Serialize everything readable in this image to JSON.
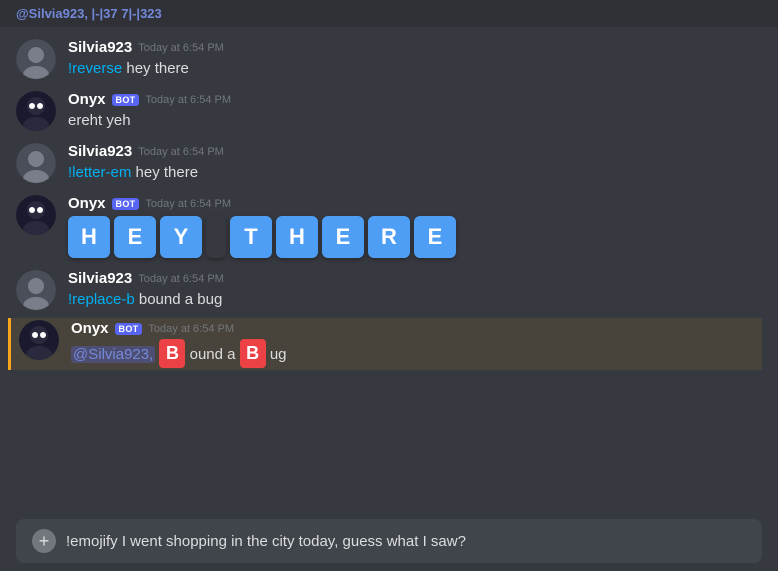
{
  "mention_bar": {
    "text": "@Silvia923, |-|37 7|-|323"
  },
  "messages": [
    {
      "id": "msg1",
      "avatar_type": "user",
      "username": "Silvia923",
      "is_bot": false,
      "timestamp": "Today at 6:54 PM",
      "text": "!reverse hey there",
      "type": "normal"
    },
    {
      "id": "msg2",
      "avatar_type": "bot",
      "username": "Onyx",
      "is_bot": true,
      "timestamp": "Today at 6:54 PM",
      "text": "ereht yeh",
      "type": "normal"
    },
    {
      "id": "msg3",
      "avatar_type": "user",
      "username": "Silvia923",
      "is_bot": false,
      "timestamp": "Today at 6:54 PM",
      "text": "!letter-em hey there",
      "type": "normal"
    },
    {
      "id": "msg4",
      "avatar_type": "bot",
      "username": "Onyx",
      "is_bot": true,
      "timestamp": "Today at 6:54 PM",
      "tiles": [
        "H",
        "E",
        "Y",
        " ",
        "T",
        "H",
        "E",
        "R",
        "E"
      ],
      "type": "tiles"
    },
    {
      "id": "msg5",
      "avatar_type": "user",
      "username": "Silvia923",
      "is_bot": false,
      "timestamp": "Today at 6:54 PM",
      "text": "!replace-b bound a bug",
      "type": "normal"
    },
    {
      "id": "msg6",
      "avatar_type": "bot",
      "username": "Onyx",
      "is_bot": true,
      "timestamp": "Today at 6:54 PM",
      "mention": "@Silvia923,",
      "replace_parts": [
        {
          "type": "text",
          "value": " "
        },
        {
          "type": "highlight",
          "value": "B"
        },
        {
          "type": "text",
          "value": "ound a "
        },
        {
          "type": "highlight",
          "value": "B"
        },
        {
          "type": "text",
          "value": "ug"
        }
      ],
      "type": "replace",
      "highlighted": true
    }
  ],
  "input": {
    "placeholder": "!emojify I went shopping in the city today, guess what I saw?",
    "add_icon": "+"
  }
}
